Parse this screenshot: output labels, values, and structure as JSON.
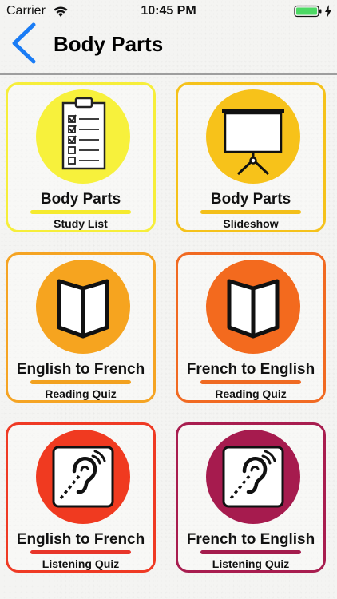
{
  "status_bar": {
    "carrier": "Carrier",
    "time": "10:45 PM",
    "icons": [
      "wifi-icon",
      "battery-icon",
      "charging-icon"
    ],
    "battery_color": "#4cd964"
  },
  "nav": {
    "back_icon": "chevron-left-icon",
    "back_color": "#1a7cf5",
    "title": "Body Parts"
  },
  "cards": [
    {
      "title": "Body Parts",
      "subtitle": "Study List",
      "icon": "clipboard-checklist-icon",
      "border_color": "#f6ee3a",
      "circle_color": "#f7f13c",
      "underline_color": "#f5ea2e"
    },
    {
      "title": "Body Parts",
      "subtitle": "Slideshow",
      "icon": "projector-screen-icon",
      "border_color": "#f5c21b",
      "circle_color": "#f7c21a",
      "underline_color": "#f3bf1a"
    },
    {
      "title": "English to French",
      "subtitle": "Reading Quiz",
      "icon": "open-book-icon",
      "border_color": "#f5a423",
      "circle_color": "#f6a41f",
      "underline_color": "#f2a11f"
    },
    {
      "title": "French to English",
      "subtitle": "Reading Quiz",
      "icon": "open-book-icon",
      "border_color": "#f16a22",
      "circle_color": "#f36a1e",
      "underline_color": "#ef6a22"
    },
    {
      "title": "English to French",
      "subtitle": "Listening Quiz",
      "icon": "hearing-ear-icon",
      "border_color": "#ef3a24",
      "circle_color": "#f03a20",
      "underline_color": "#e8362a"
    },
    {
      "title": "French to English",
      "subtitle": "Listening Quiz",
      "icon": "hearing-ear-icon",
      "border_color": "#a81d4f",
      "circle_color": "#a61b4e",
      "underline_color": "#a41c4d"
    }
  ]
}
